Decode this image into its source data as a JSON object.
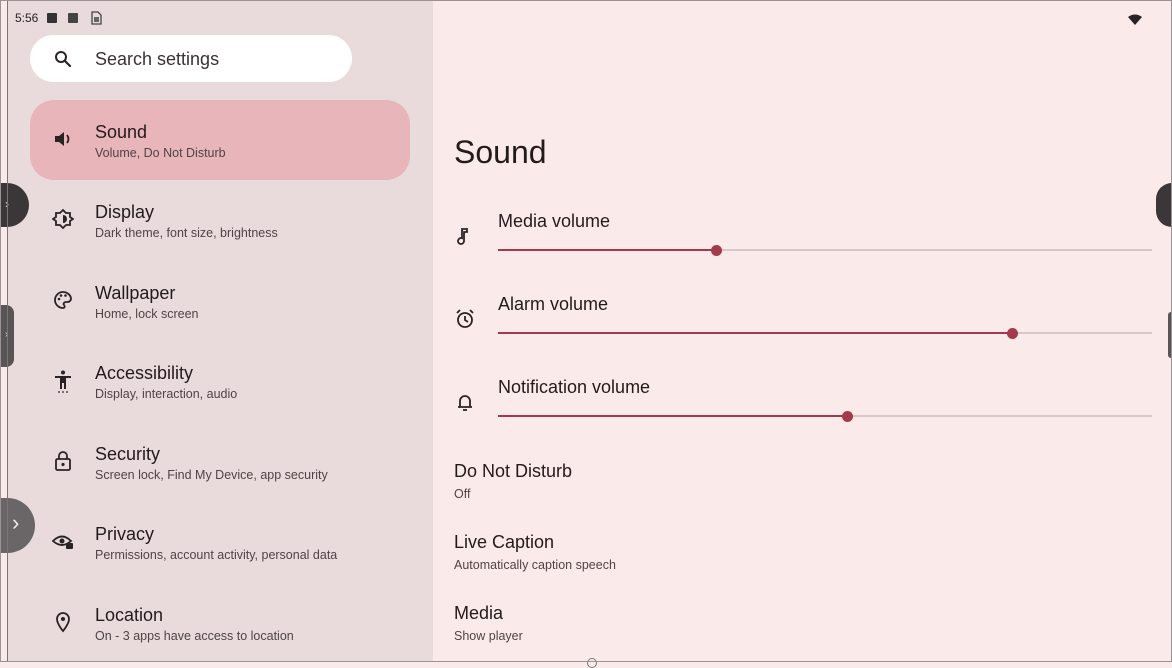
{
  "status_bar": {
    "time": "5:56"
  },
  "search": {
    "placeholder": "Search settings"
  },
  "sidebar": {
    "items": [
      {
        "title": "Sound",
        "subtitle": "Volume, Do Not Disturb",
        "icon": "speaker-icon",
        "selected": true
      },
      {
        "title": "Display",
        "subtitle": "Dark theme, font size, brightness",
        "icon": "brightness-icon"
      },
      {
        "title": "Wallpaper",
        "subtitle": "Home, lock screen",
        "icon": "palette-icon"
      },
      {
        "title": "Accessibility",
        "subtitle": "Display, interaction, audio",
        "icon": "accessibility-icon"
      },
      {
        "title": "Security",
        "subtitle": "Screen lock, Find My Device, app security",
        "icon": "lock-icon"
      },
      {
        "title": "Privacy",
        "subtitle": "Permissions, account activity, personal data",
        "icon": "privacy-eye-icon"
      },
      {
        "title": "Location",
        "subtitle": "On - 3 apps have access to location",
        "icon": "location-pin-icon"
      }
    ]
  },
  "main": {
    "title": "Sound",
    "volumes": [
      {
        "label": "Media volume",
        "icon": "music-note-icon",
        "level": 0.333
      },
      {
        "label": "Alarm volume",
        "icon": "alarm-clock-icon",
        "level": 0.786
      },
      {
        "label": "Notification volume",
        "icon": "bell-icon",
        "level": 0.533
      }
    ],
    "prefs": [
      {
        "title": "Do Not Disturb",
        "subtitle": "Off"
      },
      {
        "title": "Live Caption",
        "subtitle": "Automatically caption speech"
      },
      {
        "title": "Media",
        "subtitle": "Show player"
      }
    ]
  },
  "colors": {
    "accent": "#a33a4b",
    "selected_bg": "#e8b5bb",
    "sidebar_bg": "#e9dbdc",
    "main_bg": "#fbeaea"
  }
}
